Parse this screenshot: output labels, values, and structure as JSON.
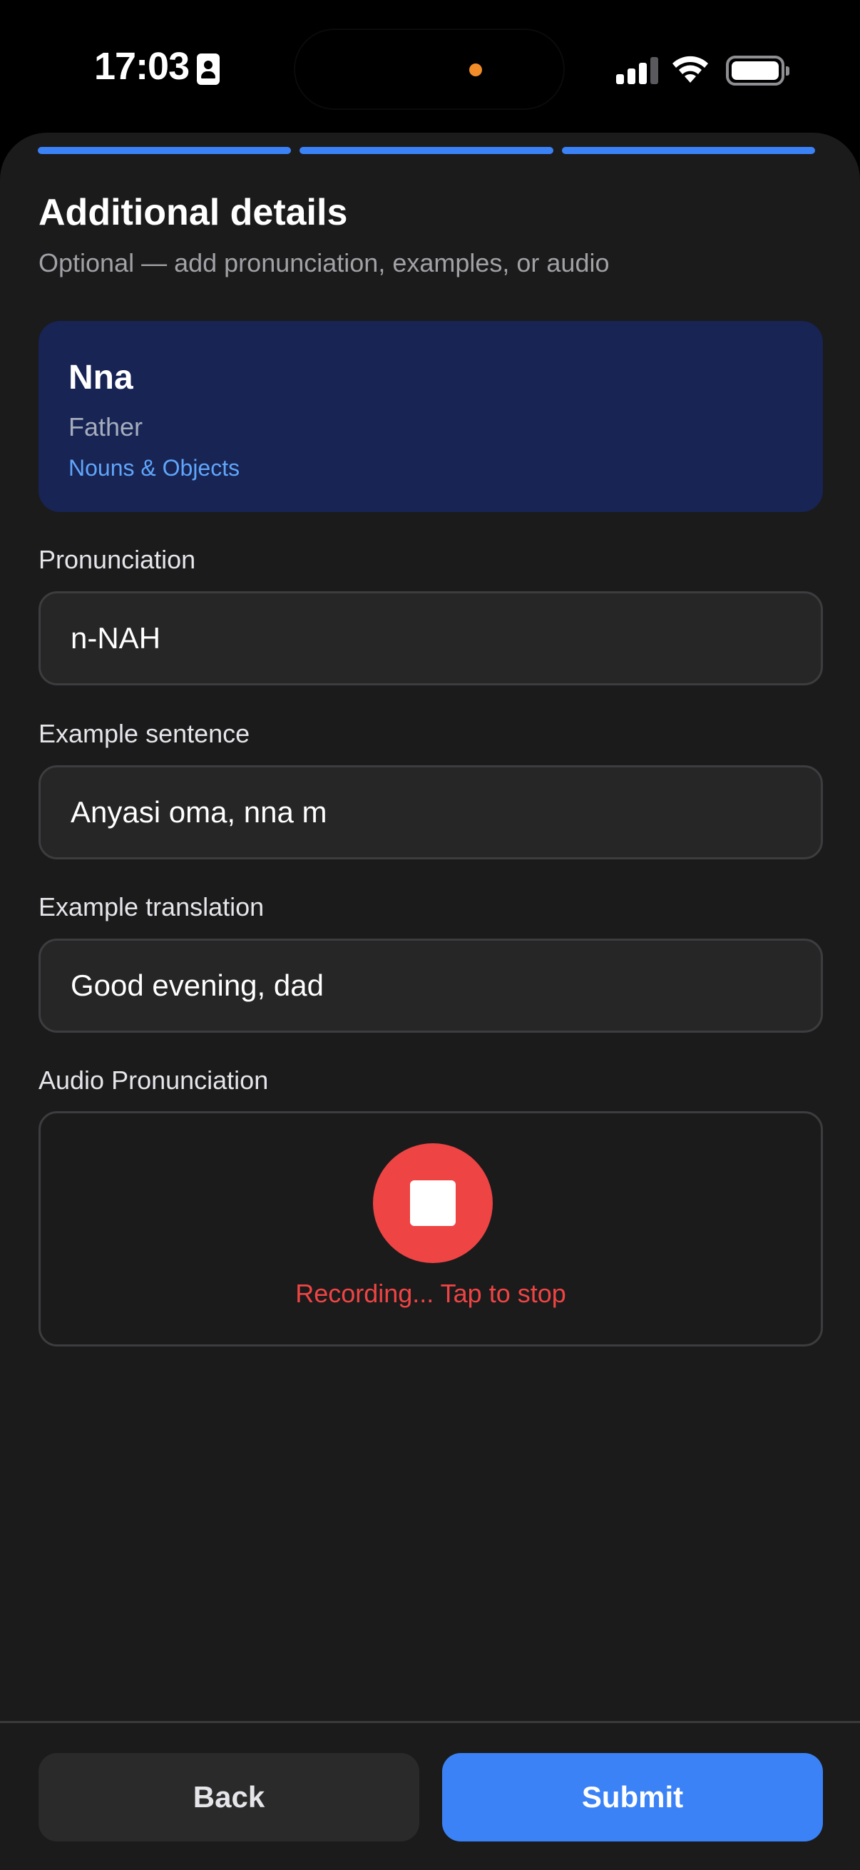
{
  "status_bar": {
    "time": "17:03"
  },
  "progress": {
    "steps_total": 3,
    "steps_complete": 3
  },
  "header": {
    "title": "Additional details",
    "subtitle": "Optional — add pronunciation, examples, or audio"
  },
  "word_card": {
    "word": "Nna",
    "meaning": "Father",
    "category": "Nouns & Objects"
  },
  "form": {
    "pronunciation": {
      "label": "Pronunciation",
      "value": "n-NAH"
    },
    "example_sentence": {
      "label": "Example sentence",
      "value": "Anyasi oma, nna m"
    },
    "example_translation": {
      "label": "Example translation",
      "value": "Good evening, dad"
    },
    "audio": {
      "label": "Audio Pronunciation",
      "status": "Recording... Tap to stop"
    }
  },
  "footer": {
    "back_label": "Back",
    "submit_label": "Submit"
  },
  "colors": {
    "accent": "#3b82f6",
    "recording": "#ef4444",
    "card": "#172454",
    "background": "#1b1b1c"
  }
}
